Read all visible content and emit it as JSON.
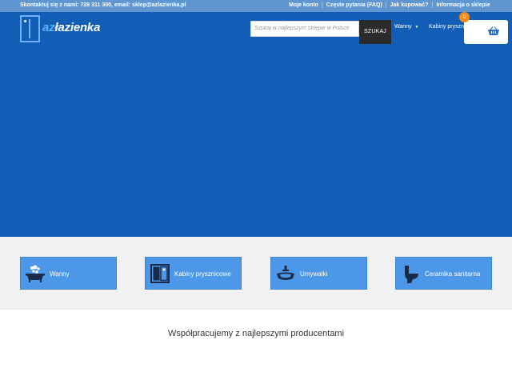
{
  "topbar": {
    "contact": "Skontaktuj się z nami: 728 311 300, email: sklep@azlazienka.pl",
    "links": [
      "Moje konto",
      "Częste pytania (FAQ)",
      "Jak kupować?",
      "Informacja o sklepie"
    ]
  },
  "header": {
    "logo_az": "az",
    "logo_rest": "łazienka",
    "search_placeholder": "Szukaj w najlepszym sklepie w Polsce",
    "search_button": "SZUKAJ",
    "nav": [
      "Wanny",
      "Kabiny prysznicowe"
    ],
    "cart_count": "0"
  },
  "categories": [
    {
      "label": "Wanny",
      "icon": "bathtub-icon"
    },
    {
      "label": "Kabiny prysznicowe",
      "icon": "shower-cabin-icon"
    },
    {
      "label": "Umywalki",
      "icon": "washbasin-icon"
    },
    {
      "label": "Ceramika sanitarna",
      "icon": "toilet-icon"
    }
  ],
  "partners": {
    "heading": "Współpracujemy z najlepszymi producentami"
  },
  "colors": {
    "hero": "#125eb6",
    "topbar": "#5f96d0",
    "category_button": "#4d97e8",
    "cart_badge": "#f28c18"
  }
}
